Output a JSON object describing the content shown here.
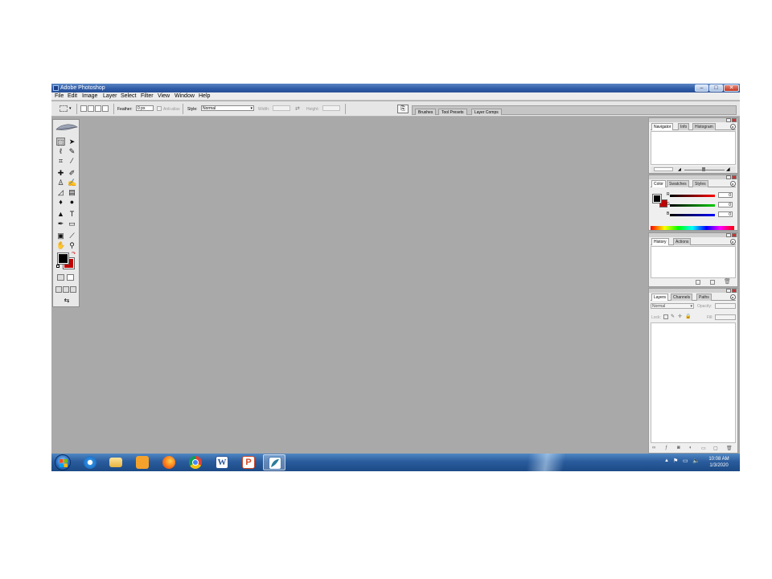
{
  "window": {
    "title": "Adobe Photoshop"
  },
  "menu": [
    "File",
    "Edit",
    "Image",
    "Layer",
    "Select",
    "Filter",
    "View",
    "Window",
    "Help"
  ],
  "options": {
    "feather_label": "Feather:",
    "feather_value": "0 px",
    "antialias_label": "Anti-alias",
    "style_label": "Style:",
    "style_value": "Normal",
    "width_label": "Width:",
    "height_label": "Height:"
  },
  "palette_well": [
    "Brushes",
    "Tool Presets",
    "Layer Comps"
  ],
  "panels": {
    "navigator_tabs": [
      "Navigator",
      "Info",
      "Histogram"
    ],
    "color_tabs": [
      "Color",
      "Swatches",
      "Styles"
    ],
    "color": {
      "channels": [
        {
          "label": "R",
          "value": "0"
        },
        {
          "label": "G",
          "value": "0"
        },
        {
          "label": "B",
          "value": "0"
        }
      ],
      "foreground": "#000000",
      "background": "#c00000"
    },
    "history_tabs": [
      "History",
      "Actions"
    ],
    "layers_tabs": [
      "Layers",
      "Channels",
      "Paths"
    ],
    "layers": {
      "blend_mode": "Normal",
      "opacity_label": "Opacity:",
      "lock_label": "Lock:",
      "fill_label": "Fill:"
    }
  },
  "taskbar": {
    "apps": [
      "windows-explorer",
      "internet-explorer",
      "file-explorer",
      "media-player",
      "firefox",
      "chrome",
      "word",
      "powerpoint",
      "photoshop"
    ],
    "clock_time": "10:08 AM",
    "clock_date": "1/3/2020"
  },
  "colors": {
    "workspace": "#a9a9a9",
    "titlebar": "#2e5aa6",
    "taskbar": "#2a5c9d"
  }
}
